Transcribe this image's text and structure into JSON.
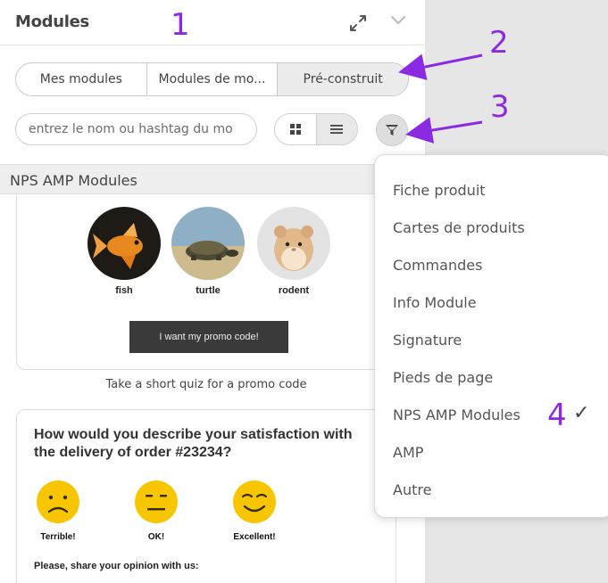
{
  "header": {
    "title": "Modules"
  },
  "annotations": [
    "1",
    "2",
    "3",
    "4"
  ],
  "tabs": [
    "Mes modules",
    "Modules de mo...",
    "Pré-construit"
  ],
  "search": {
    "placeholder": "entrez le nom ou hashtag du mo"
  },
  "section": {
    "title": "NPS AMP Modules"
  },
  "card1": {
    "pets": [
      "fish",
      "turtle",
      "rodent"
    ],
    "button": "I want my promo code!",
    "caption": "Take a short quiz for a promo code"
  },
  "card2": {
    "question": "How would you describe your satisfaction with the delivery of order #23234?",
    "faces": [
      "Terrible!",
      "OK!",
      "Excellent!"
    ],
    "share": "Please, share your opinion with us:"
  },
  "dropdown": {
    "items": [
      "Fiche produit",
      "Cartes de produits",
      "Commandes",
      "Info Module",
      "Signature",
      "Pieds de page",
      "NPS AMP Modules",
      "AMP",
      "Autre"
    ],
    "checkmark": "✓"
  },
  "colors": {
    "annotation": "#8a2be2",
    "face": "#f7c600"
  },
  "icons": [
    "expand-icon",
    "chevron-down-icon",
    "grid-icon",
    "list-icon",
    "filter-icon"
  ]
}
